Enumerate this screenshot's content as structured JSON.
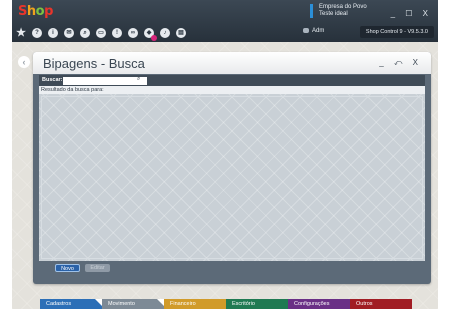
{
  "app": {
    "logo": [
      "S",
      "h",
      "o",
      "p"
    ],
    "company_name": "Empresa do Povo",
    "company_sub": "Teste ideal",
    "user": "Adm",
    "version": "Shop Control 9 - V9.5.3.0",
    "win_controls": "_ ☐ X"
  },
  "toolbar": {
    "icons": [
      "star-icon",
      "help-icon",
      "info-icon",
      "mail-icon",
      "search-icon",
      "print-icon",
      "alert-icon",
      "link-icon",
      "badge-icon",
      "sound-icon",
      "calculator-icon"
    ]
  },
  "window": {
    "title": "Bipagens - Busca",
    "controls": "_ ⤺ X"
  },
  "search": {
    "label": "Buscar:",
    "value": "",
    "placeholder": ""
  },
  "results": {
    "label": "Resultado da busca para:"
  },
  "buttons": {
    "new": "Novo",
    "edit": "Editar"
  },
  "nav": [
    {
      "label": "Cadastros",
      "color": "#2c6fb7"
    },
    {
      "label": "Movimento",
      "color": "#7d8a96"
    },
    {
      "label": "Financeiro",
      "color": "#d19b2a"
    },
    {
      "label": "Escritório",
      "color": "#1f7a52"
    },
    {
      "label": "Configurações",
      "color": "#6a2f86"
    },
    {
      "label": "Outros",
      "color": "#a11d24"
    }
  ]
}
